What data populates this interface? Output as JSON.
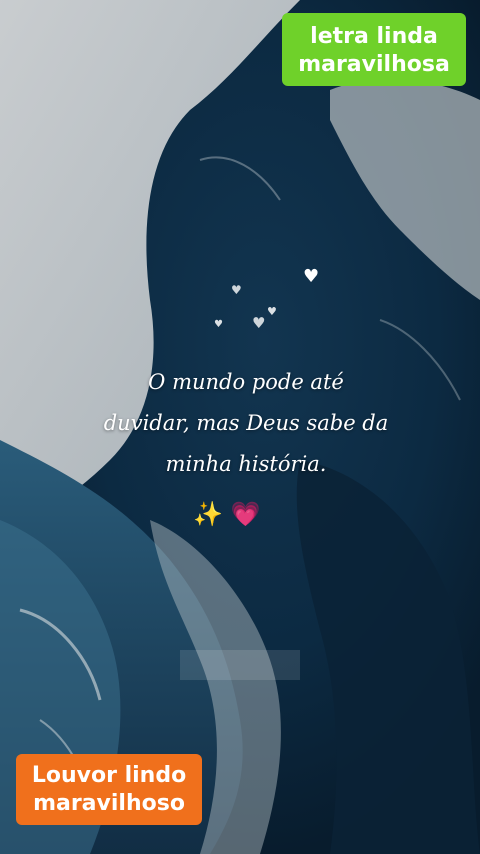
{
  "top_badge": {
    "line1": "letra linda",
    "line2": "maravilhosa",
    "color": "#6fd12a"
  },
  "quote": {
    "line1": "O mundo pode até",
    "line2": "duvidar, mas Deus sabe da",
    "line3": "minha história."
  },
  "emoji": "✨ 💗",
  "bottom_badge": {
    "line1": "Louvor lindo",
    "line2": "maravilhoso",
    "color": "#f0701c"
  },
  "colors": {
    "ocean_dark": "#0d2a40",
    "ocean_mid": "#1e4a6a",
    "foam": "#c9ced2"
  }
}
